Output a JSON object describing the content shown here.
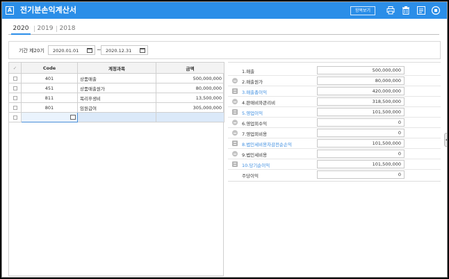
{
  "app": {
    "icon_letter": "A",
    "title": "전기분손익계산서",
    "view_button": "항목보기"
  },
  "toolbar_icons": [
    "printer-icon",
    "trash-icon",
    "list-form-icon",
    "close-circle-icon"
  ],
  "tabs": [
    {
      "label": "2020",
      "active": true
    },
    {
      "label": "2019",
      "active": false
    },
    {
      "label": "2018",
      "active": false
    }
  ],
  "period": {
    "label": "기간  제20기",
    "start": "2020.01.01",
    "tilde": "~",
    "end": "2020.12.31"
  },
  "grid": {
    "headers": {
      "check": "✓",
      "code": "Code",
      "account": "계정과목",
      "amount": "금액"
    },
    "rows": [
      {
        "code": "401",
        "account": "상품매출",
        "amount": "500,000,000"
      },
      {
        "code": "451",
        "account": "상품매출원가",
        "amount": "80,000,000"
      },
      {
        "code": "811",
        "account": "복리후생비",
        "amount": "13,500,000"
      },
      {
        "code": "801",
        "account": "임원급여",
        "amount": "305,000,000"
      }
    ]
  },
  "summary": [
    {
      "icon": "none",
      "label": "1.매출",
      "value": "500,000,000",
      "highlight": false
    },
    {
      "icon": "minus",
      "label": "2.매출원가",
      "value": "80,000,000",
      "highlight": false
    },
    {
      "icon": "equals",
      "label": "3.매출총이익",
      "value": "420,000,000",
      "highlight": true
    },
    {
      "icon": "minus",
      "label": "4.판매비와관리비",
      "value": "318,500,000",
      "highlight": false
    },
    {
      "icon": "equals",
      "label": "5.영업이익",
      "value": "101,500,000",
      "highlight": true
    },
    {
      "icon": "plus",
      "label": "6.영업외수익",
      "value": "0",
      "highlight": false
    },
    {
      "icon": "minus",
      "label": "7.영업외비용",
      "value": "0",
      "highlight": false
    },
    {
      "icon": "equals",
      "label": "8.법인세비용차감전순손익",
      "value": "101,500,000",
      "highlight": true
    },
    {
      "icon": "minus",
      "label": "9.법인세비용",
      "value": "0",
      "highlight": false
    },
    {
      "icon": "equals",
      "label": "10.당기순이익",
      "value": "101,500,000",
      "highlight": true
    },
    {
      "icon": "none",
      "label": "주당이익",
      "value": "0",
      "highlight": false
    }
  ],
  "colors": {
    "titlebar": "#2b8ee8",
    "highlight_label": "#3c8de0"
  }
}
